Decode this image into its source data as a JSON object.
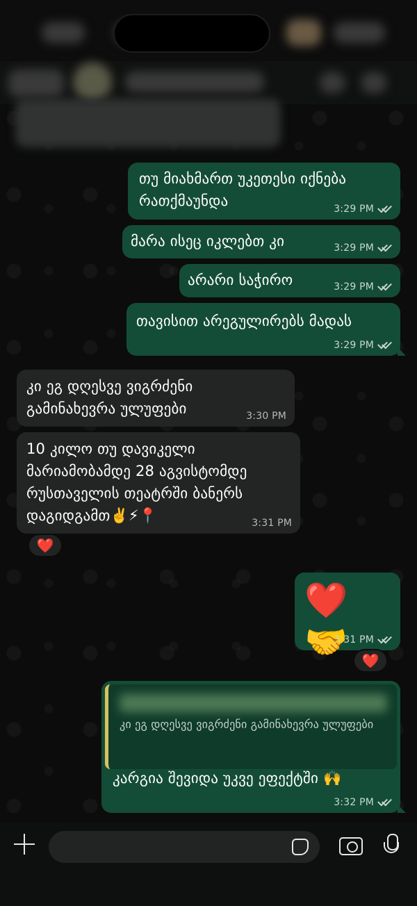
{
  "messages": [
    {
      "id": "m1",
      "direction": "out",
      "text": "თუ მიახმართ უკეთესი იქნება\nრათქმაუნდა",
      "time": "3:29 PM"
    },
    {
      "id": "m2",
      "direction": "out",
      "text": "მარა ისეც იკლებთ კი",
      "time": "3:29 PM"
    },
    {
      "id": "m3",
      "direction": "out",
      "text": "არარი საჭირო",
      "time": "3:29 PM"
    },
    {
      "id": "m4",
      "direction": "out",
      "text": "თავისით არეგულირებს მადას",
      "time": "3:29 PM"
    },
    {
      "id": "m5",
      "direction": "in",
      "text": "კი ეგ დღესვე ვიგრძენი\nგამინახევრა ულუფები",
      "time": "3:30 PM"
    },
    {
      "id": "m6",
      "direction": "in",
      "text": "10 კილო თუ დავიკელი\nმარიამობამდე 28 აგვისტომდე\nრუსთაველის თეატრში ბანერს\nდაგიდგამთ✌️⚡📍",
      "time": "3:31 PM",
      "reaction": "❤️"
    },
    {
      "id": "m7",
      "direction": "out",
      "text": "❤️🤝",
      "time": "3:31 PM",
      "reaction": "❤️"
    },
    {
      "id": "m8",
      "direction": "out",
      "quote": "კი ეგ დღესვე ვიგრძენი გამინახევრა\nულუფები",
      "text": "კარგია შევიდა უკვე ეფექტში 🙌",
      "time": "3:32 PM"
    }
  ]
}
